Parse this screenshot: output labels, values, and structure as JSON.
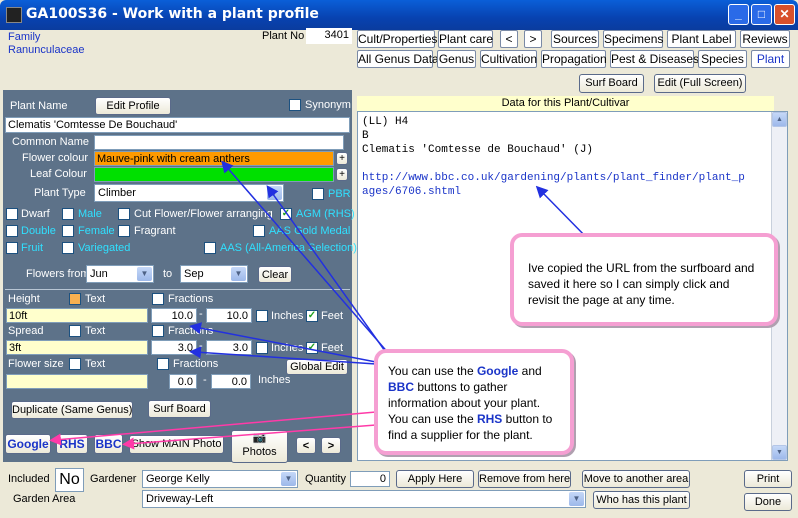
{
  "window": {
    "title": "GA100S36 - Work with a plant profile",
    "min_glyph": "_",
    "max_glyph": "□",
    "close_glyph": "✕"
  },
  "header": {
    "family_label": "Family",
    "family_value": "Ranunculaceae",
    "plant_no_label": "Plant No",
    "plant_no_value": "3401"
  },
  "tabs_row1": [
    "Cult/Properties",
    "Plant care",
    "<",
    ">",
    "Sources",
    "Specimens",
    "Plant Label",
    "Reviews"
  ],
  "tabs_row2": [
    "All Genus Data",
    "Genus",
    "Cultivation",
    "Propagation",
    "Pest & Diseases",
    "Species",
    "Plant"
  ],
  "left": {
    "plant_name_label": "Plant Name",
    "edit_profile_button": "Edit Profile",
    "synonym_label": "Synonym",
    "plant_name_value": "Clematis 'Comtesse De Bouchaud'",
    "common_name_label": "Common Name",
    "common_name_value": "",
    "flower_colour_label": "Flower colour",
    "flower_colour_value": "Mauve-pink with cream anthers",
    "leaf_colour_label": "Leaf Colour",
    "leaf_colour_value": "",
    "plus_glyph": "+",
    "plant_type_label": "Plant Type",
    "plant_type_value": "Climber",
    "pbr_label": "PBR",
    "checkboxes": {
      "dwarf": "Dwarf",
      "male": "Male",
      "cut_flower": "Cut Flower/Flower arranging",
      "agm": "AGM (RHS)",
      "double": "Double",
      "female": "Female",
      "fragrant": "Fragrant",
      "aas_gold": "AAS Gold Medal",
      "fruit": "Fruit",
      "variegated": "Variegated",
      "aas_all": "AAS (All-America Selection)"
    },
    "check_mark": "✓",
    "flowers_from_label": "Flowers from",
    "flowers_from_value": "Jun",
    "to_label": "to",
    "flowers_to_value": "Sep",
    "clear_button": "Clear",
    "height_label": "Height",
    "text_label": "Text",
    "fractions_label": "Fractions",
    "height_value": "10ft",
    "height_min": "10.0",
    "height_max": "10.0",
    "dash": "-",
    "inches_label": "Inches",
    "feet_label": "Feet",
    "spread_label": "Spread",
    "spread_value": "3ft",
    "spread_min": "3.0",
    "spread_max": "3.0",
    "global_edit_button": "Global Edit",
    "flower_size_label": "Flower size",
    "flower_size_value": "",
    "flower_size_min": "0.0",
    "flower_size_max": "0.0",
    "duplicate_button": "Duplicate (Same Genus)",
    "surf_board_button": "Surf Board"
  },
  "links": {
    "google": "Google",
    "rhs": "RHS",
    "bbc": "BBC",
    "show_main_photo": "Show MAIN Photo",
    "photos": "Photos",
    "camera_glyph": "📷",
    "prev": "<",
    "next": ">"
  },
  "right": {
    "surf_board_button": "Surf Board",
    "edit_full_button": "Edit (Full Screen)",
    "data_header": "Data for this Plant/Cultivar",
    "data_lines": [
      "(LL) H4",
      "B",
      "Clematis 'Comtesse de Bouchaud' (J)",
      ""
    ],
    "url_line1": "http://www.bbc.co.uk/gardening/plants/plant_finder/plant_p",
    "url_line2": "ages/6706.shtml",
    "scroll_up": "▲",
    "scroll_down": "▼"
  },
  "callouts": {
    "top": "Ive copied the URL from the surfboard and saved it here so I can simply click and revisit the page at any time.",
    "bottom_1": "You can use the ",
    "bottom_google": "Google",
    "bottom_2": " and ",
    "bottom_bbc": "BBC",
    "bottom_3": " buttons to gather information about your plant. You can use the ",
    "bottom_rhs": "RHS",
    "bottom_4": " button to find a supplier for the plant."
  },
  "bottom": {
    "included_label": "Included",
    "included_value": "No",
    "gardener_label": "Gardener",
    "gardener_value": "George Kelly",
    "quantity_label": "Quantity",
    "quantity_value": "0",
    "apply_here": "Apply Here",
    "remove_from_here": "Remove from here",
    "move_area": "Move to another area",
    "print": "Print",
    "garden_area_label": "Garden Area",
    "garden_area_value": "Driveway-Left",
    "who_has": "Who has this plant",
    "done": "Done",
    "dropdown_arrow": "▼"
  },
  "colors": {
    "flower_colour_fill": "#ff9a00",
    "leaf_colour_fill": "#00e000",
    "panel_bg": "#5d7289",
    "callout_border": "#f59fd2",
    "arrow_blue": "#2230e0",
    "arrow_pink": "#ff3aa8"
  }
}
